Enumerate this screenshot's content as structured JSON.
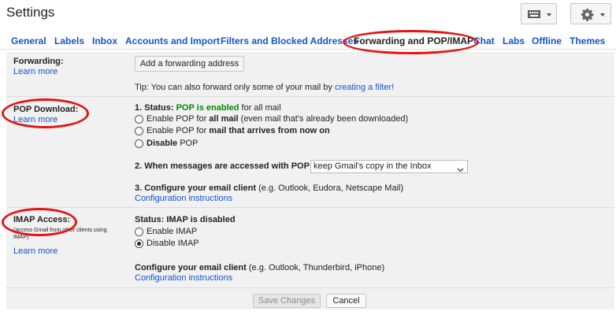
{
  "header": {
    "title": "Settings"
  },
  "icons": {
    "keyboard": "keyboard-icon",
    "gear": "gear-icon",
    "dropdown": "chevron-down-icon"
  },
  "tabs": [
    {
      "label": "General"
    },
    {
      "label": "Labels"
    },
    {
      "label": "Inbox"
    },
    {
      "label": "Accounts and Import"
    },
    {
      "label": "Filters and Blocked Addresses"
    },
    {
      "label": "Forwarding and POP/IMAP"
    },
    {
      "label": "Chat"
    },
    {
      "label": "Labs"
    },
    {
      "label": "Offline"
    },
    {
      "label": "Themes"
    }
  ],
  "forwarding": {
    "label": "Forwarding:",
    "learn_more": "Learn more",
    "add_button": "Add a forwarding address",
    "tip": "Tip: You can also forward only some of your mail by",
    "tip_link": "creating a filter!"
  },
  "pop": {
    "label": "POP Download:",
    "learn_more": "Learn more",
    "status_prefix": "1. Status:",
    "status_value": "POP is enabled",
    "status_suffix": "for all mail",
    "options": [
      {
        "pre": "Enable POP for",
        "bold": "all mail",
        "post": "(even mail that's already been downloaded)",
        "checked": false
      },
      {
        "pre": "Enable POP for",
        "bold": "mail that arrives from now on",
        "post": "",
        "checked": false
      },
      {
        "pre": "",
        "bold": "Disable",
        "post": "POP",
        "checked": false
      }
    ],
    "when_label": "2. When messages are accessed with POP",
    "when_select": "keep Gmail's copy in the Inbox",
    "configure_label": "3. Configure your email client",
    "configure_hint": "(e.g. Outlook, Eudora, Netscape Mail)",
    "config_link": "Configuration instructions"
  },
  "imap": {
    "label": "IMAP Access:",
    "desc_line1": "(access Gmail from other clients using",
    "desc_line2": "IMAP)",
    "learn_more": "Learn more",
    "status": "Status: IMAP is disabled",
    "options": [
      {
        "label": "Enable IMAP",
        "checked": false
      },
      {
        "label": "Disable IMAP",
        "checked": true
      }
    ],
    "configure_label": "Configure your email client",
    "configure_hint": "(e.g. Outlook, Thunderbird, iPhone)",
    "config_link": "Configuration instructions"
  },
  "footer": {
    "save": "Save Changes",
    "cancel": "Cancel"
  },
  "colors": {
    "link": "#1155cc",
    "enabled_green": "#008800",
    "highlight": "#e01616",
    "panel": "#f1f1f1"
  }
}
